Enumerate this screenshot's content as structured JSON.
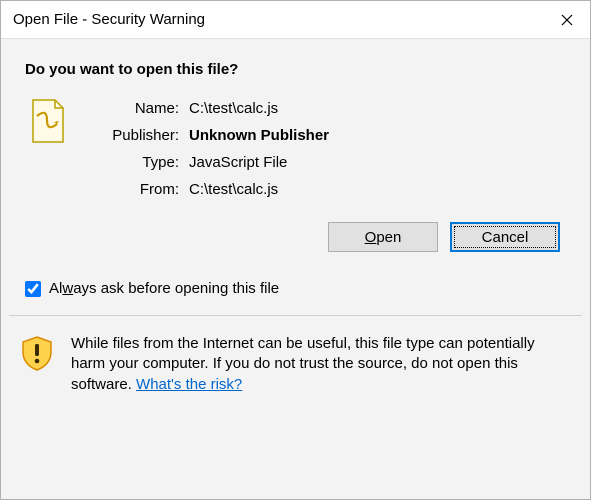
{
  "window": {
    "title": "Open File - Security Warning"
  },
  "heading": "Do you want to open this file?",
  "details": {
    "name_label": "Name:",
    "name_value": "C:\\test\\calc.js",
    "publisher_label": "Publisher:",
    "publisher_value": "Unknown Publisher",
    "type_label": "Type:",
    "type_value": "JavaScript File",
    "from_label": "From:",
    "from_value": "C:\\test\\calc.js"
  },
  "buttons": {
    "open_before": "",
    "open_mn": "O",
    "open_after": "pen",
    "cancel": "Cancel"
  },
  "always": {
    "checked": true,
    "before": "Al",
    "mn": "w",
    "after": "ays ask before opening this file"
  },
  "footer": {
    "text": "While files from the Internet can be useful, this file type can potentially harm your computer. If you do not trust the source, do not open this software. ",
    "link": "What's the risk?"
  },
  "colors": {
    "accent": "#0078d7",
    "link": "#0066cc"
  }
}
